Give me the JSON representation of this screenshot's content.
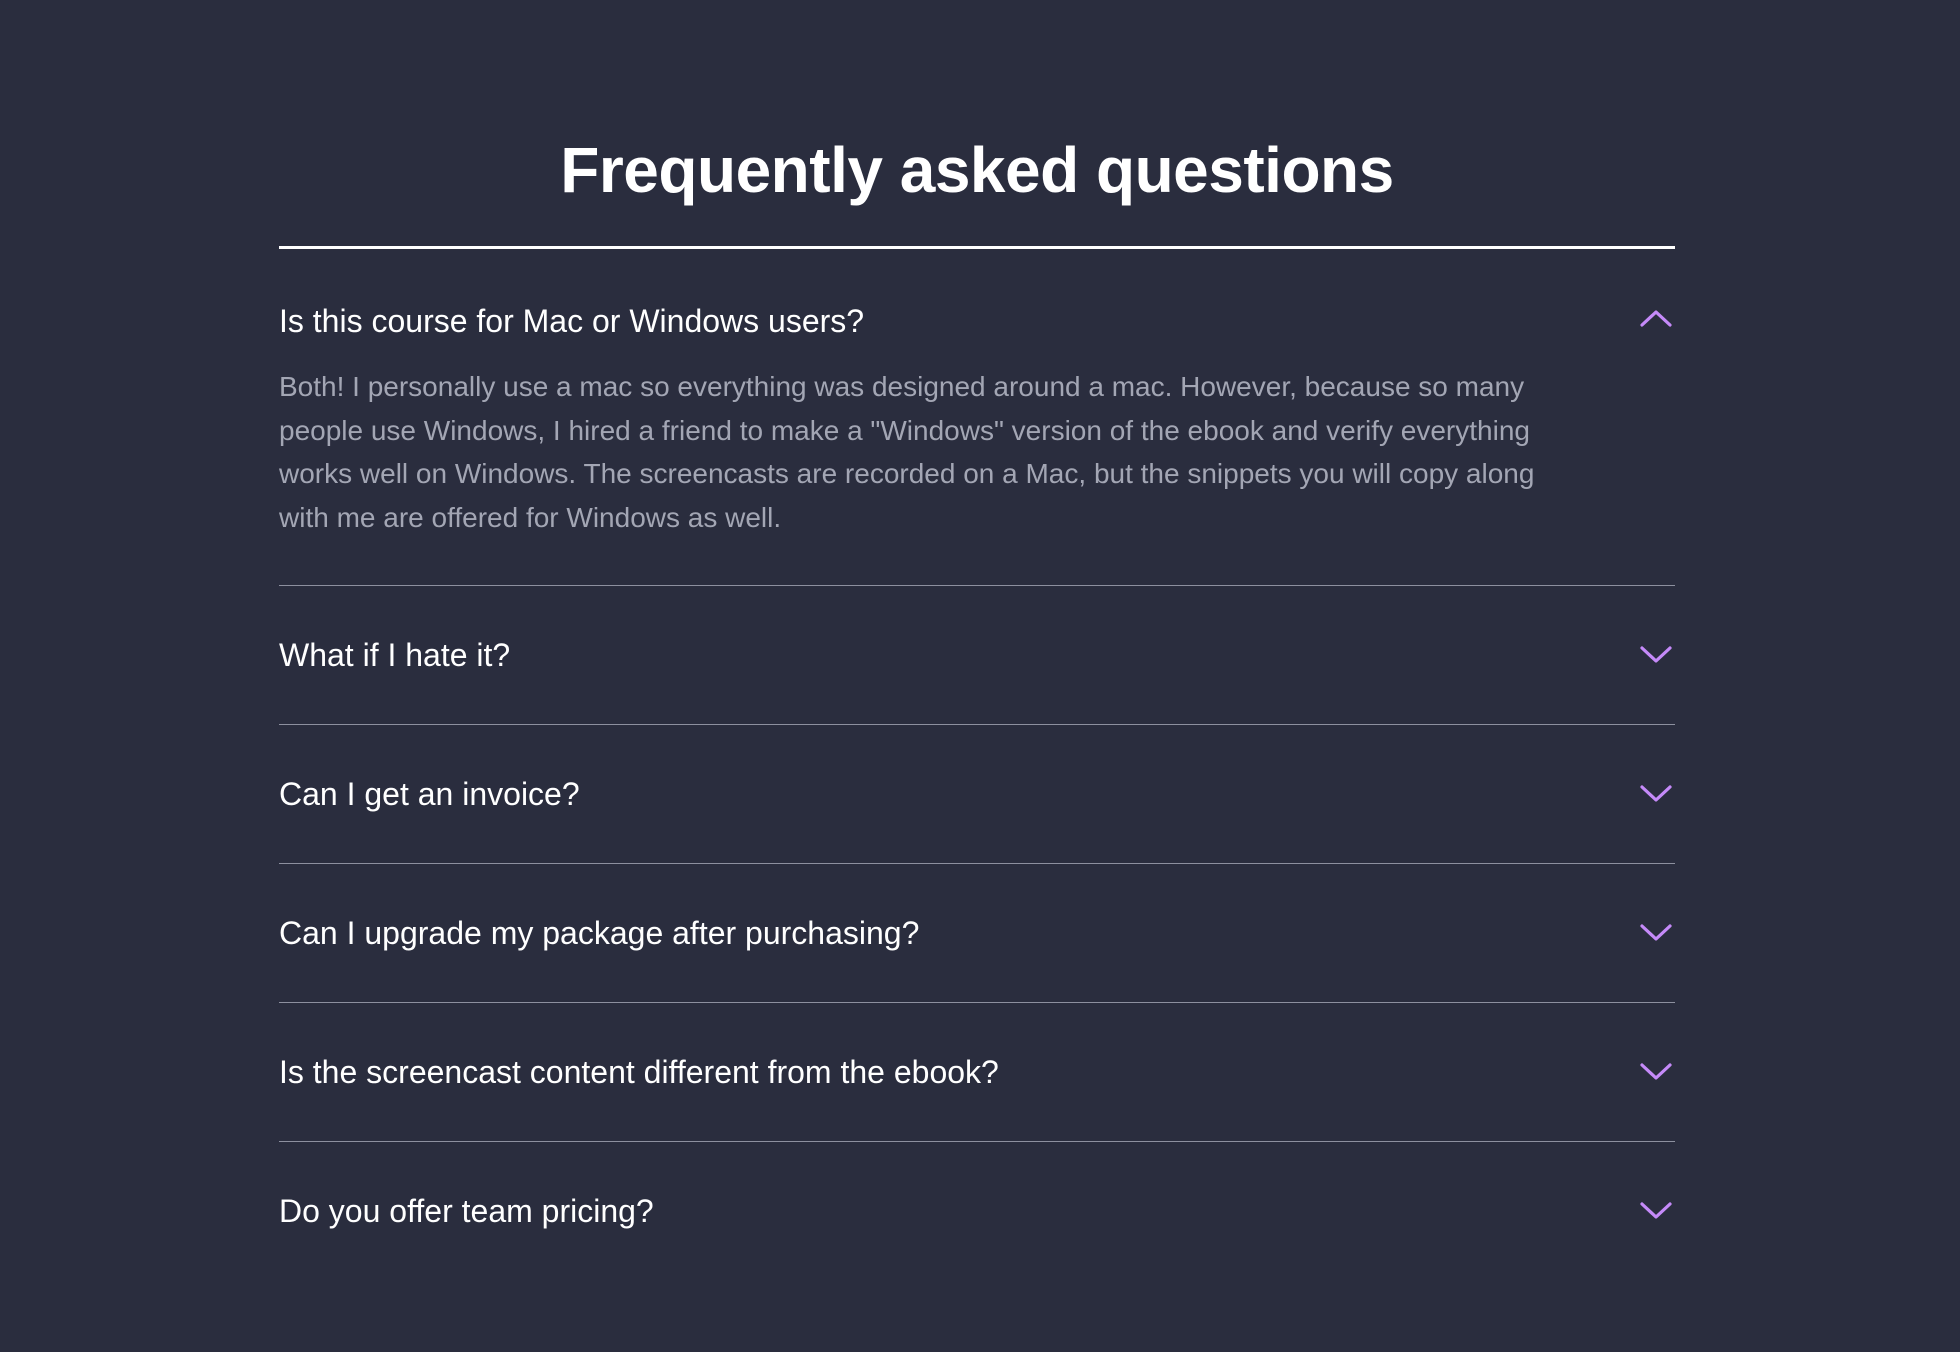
{
  "page": {
    "title": "Frequently asked questions"
  },
  "theme": {
    "background": "#2a2d3e",
    "text": "#ffffff",
    "muted_text": "#a3a6b4",
    "accent": "#c58af9",
    "divider": "#8d909f"
  },
  "faq": {
    "items": [
      {
        "question": "Is this course for Mac or Windows users?",
        "answer": "Both! I personally use a mac so everything was designed around a mac. However, because so many people use Windows, I hired a friend to make a \"Windows\" version of the ebook and verify everything works well on Windows. The screencasts are recorded on a Mac, but the snippets you will copy along with me are offered for Windows as well.",
        "expanded": true,
        "icon": "chevron-up-icon"
      },
      {
        "question": "What if I hate it?",
        "expanded": false,
        "icon": "chevron-down-icon"
      },
      {
        "question": "Can I get an invoice?",
        "expanded": false,
        "icon": "chevron-down-icon"
      },
      {
        "question": "Can I upgrade my package after purchasing?",
        "expanded": false,
        "icon": "chevron-down-icon"
      },
      {
        "question": "Is the screencast content different from the ebook?",
        "expanded": false,
        "icon": "chevron-down-icon"
      },
      {
        "question": "Do you offer team pricing?",
        "expanded": false,
        "icon": "chevron-down-icon"
      }
    ]
  }
}
